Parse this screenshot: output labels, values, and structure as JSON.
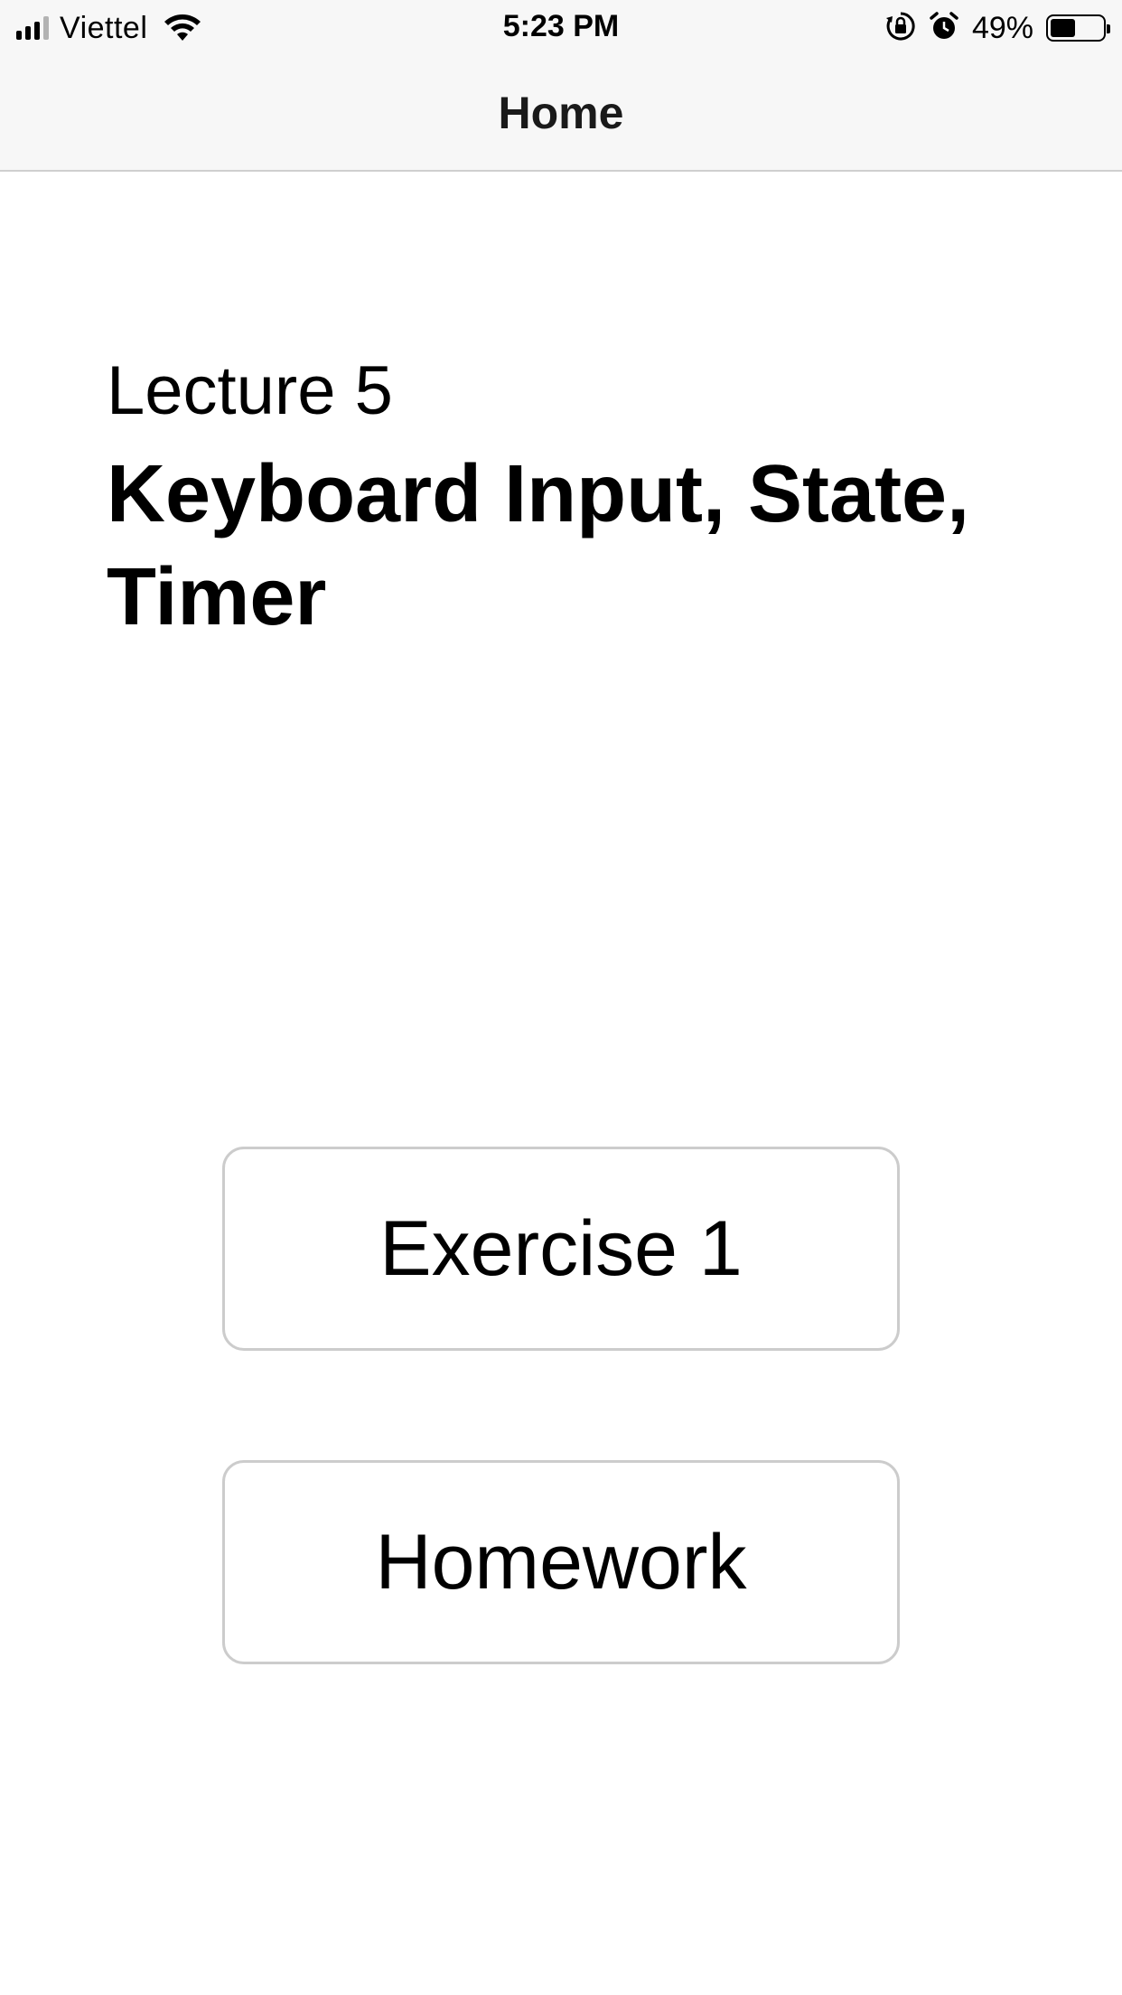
{
  "status_bar": {
    "carrier": "Viettel",
    "time": "5:23 PM",
    "battery_percent_label": "49%",
    "battery_level": 0.49,
    "signal_bars_active": 3,
    "signal_bars_total": 4,
    "icons": [
      "signal-icon",
      "wifi-icon",
      "orientation-lock-icon",
      "alarm-icon",
      "battery-icon"
    ]
  },
  "nav": {
    "title": "Home"
  },
  "content": {
    "lecture_label": "Lecture 5",
    "lecture_title": "Keyboard Input, State, Timer"
  },
  "buttons": {
    "exercise_label": "Exercise 1",
    "homework_label": "Homework"
  },
  "colors": {
    "bar_background": "#f7f7f7",
    "button_border": "#cccccc",
    "text": "#000000"
  }
}
